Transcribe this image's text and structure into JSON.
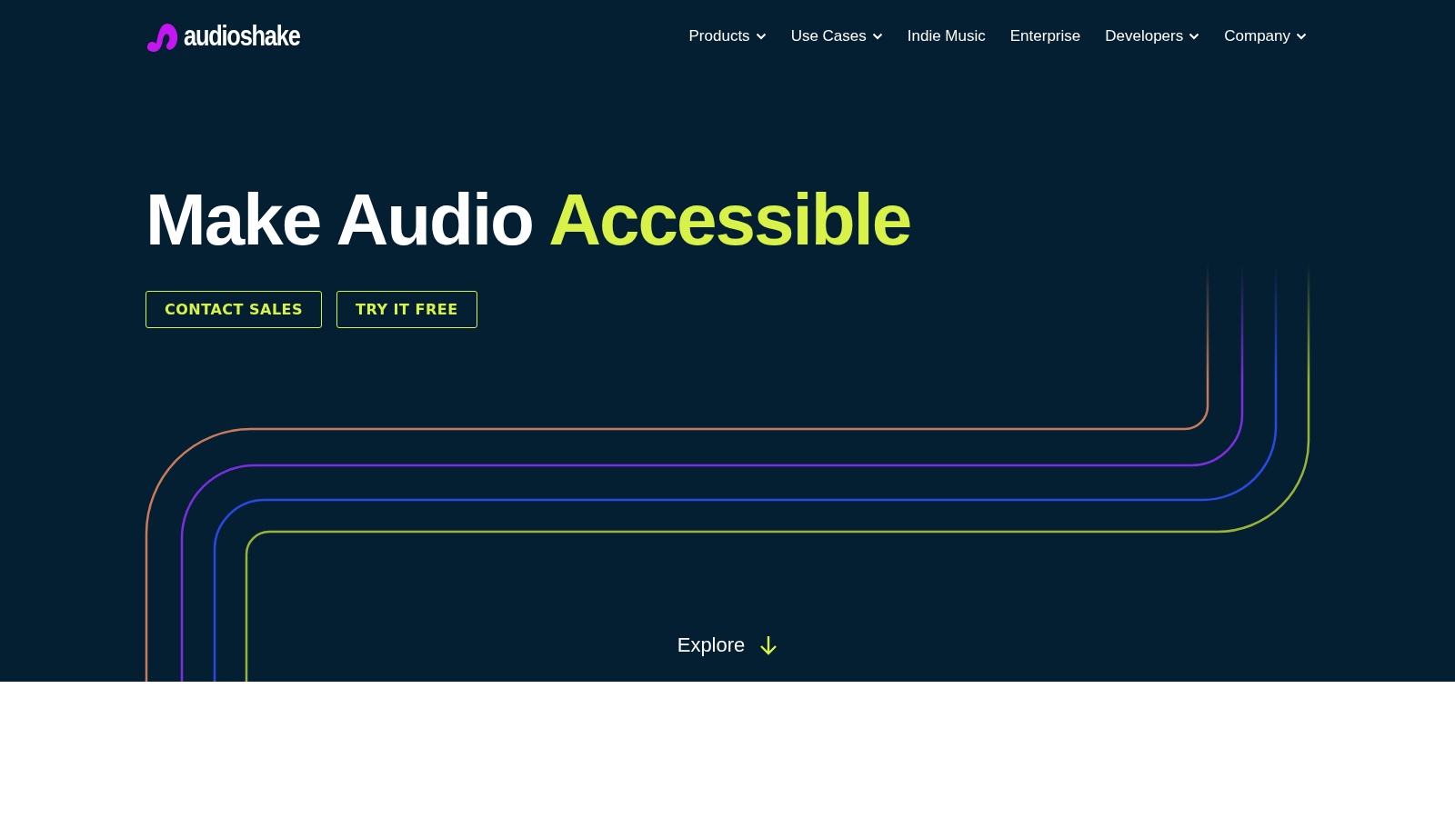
{
  "logo": {
    "text": "audioshake"
  },
  "nav": [
    {
      "label": "Products",
      "dropdown": true
    },
    {
      "label": "Use Cases",
      "dropdown": true
    },
    {
      "label": "Indie Music",
      "dropdown": false
    },
    {
      "label": "Enterprise",
      "dropdown": false
    },
    {
      "label": "Developers",
      "dropdown": true
    },
    {
      "label": "Company",
      "dropdown": true
    }
  ],
  "hero": {
    "headline": "Make Audio",
    "headline_highlight": "Accessible",
    "buttons": [
      "CONTACT SALES",
      "TRY IT FREE"
    ],
    "explore": "Explore"
  }
}
